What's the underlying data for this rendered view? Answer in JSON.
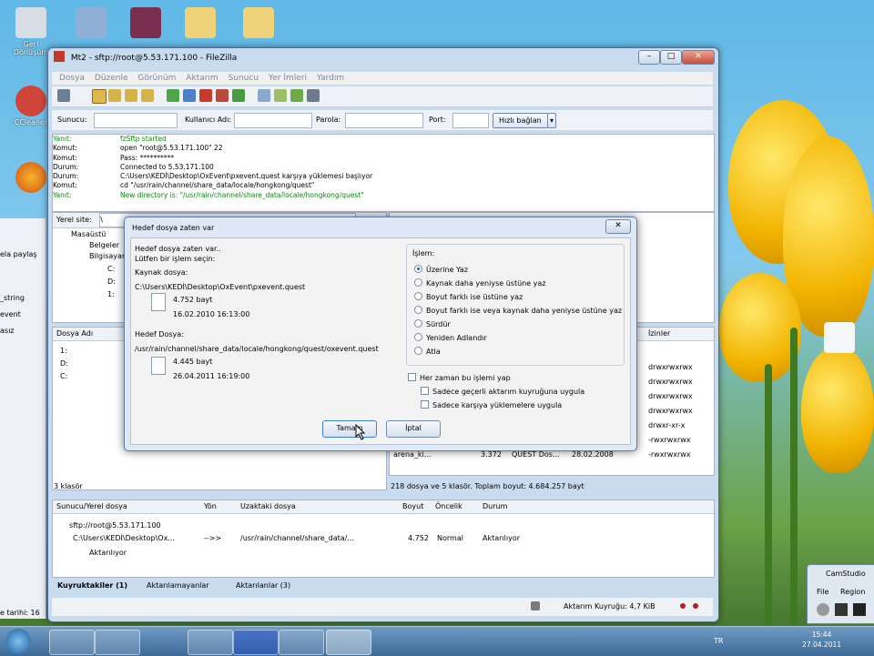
{
  "window": {
    "title": "Mt2 - sftp://root@5.53.171.100 - FileZilla",
    "btn_min": "–",
    "btn_max": "□",
    "btn_close": "✕"
  },
  "menu": [
    "Dosya",
    "Düzenle",
    "Görünüm",
    "Aktarım",
    "Sunucu",
    "Yer İmleri",
    "Yardım"
  ],
  "quickconnect": {
    "host_label": "Sunucu:",
    "user_label": "Kullanıcı Adı:",
    "pass_label": "Parola:",
    "port_label": "Port:",
    "connect_label": "Hızlı bağlan",
    "dropdown": "▾"
  },
  "log": [
    {
      "k": "Yanıt:",
      "v": "fzSftp started",
      "ok": true
    },
    {
      "k": "Komut:",
      "v": "open \"root@5.53.171.100\" 22",
      "ok": false
    },
    {
      "k": "Komut:",
      "v": "Pass: **********",
      "ok": false
    },
    {
      "k": "Durum:",
      "v": "Connected to 5.53.171.100",
      "ok": false
    },
    {
      "k": "Durum:",
      "v": "C:\\Users\\KEDİ\\Desktop\\OxEvent\\pxevent.quest karşıya yüklemesi başlıyor",
      "ok": false
    },
    {
      "k": "Komut:",
      "v": "cd \"/usr/rain/channel/share_data/locale/hongkong/quest\"",
      "ok": false
    },
    {
      "k": "Yanıt:",
      "v": "New directory is: \"/usr/rain/channel/share_data/locale/hongkong/quest\"",
      "ok": true
    }
  ],
  "local": {
    "site_label": "Yerel site:",
    "site_value": "\\",
    "tree": [
      "Masaüstü",
      "Belgeler",
      "Bilgisayar",
      "C:",
      "D:",
      "1:"
    ],
    "col_name": "Dosya Adı",
    "drives": [
      "1:",
      "D:",
      "C:"
    ],
    "status": "3 klasör"
  },
  "remote": {
    "col_perm": "İzinler",
    "perms": [
      "drwxrwxrwx",
      "drwxrwxrwx",
      "drwxrwxrwx",
      "drwxrwxrwx",
      "drwxr-xr-x",
      "-rwxrwxrwx",
      "-rwxrwxrwx"
    ],
    "row_name": "arena_ki...",
    "row_size": "3.372",
    "row_type": "QUEST Dos...",
    "row_date": "28.02.2008",
    "status": "218 dosya ve 5 klasör. Toplam boyut: 4.684.257 bayt"
  },
  "dialog": {
    "title": "Hedef dosya zaten var",
    "close": "✕",
    "msg1": "Hedef dosya zaten var..",
    "msg2": "Lütfen bir işlem seçin:",
    "source_label": "Kaynak dosya:",
    "source_path": "C:\\Users\\KEDİ\\Desktop\\OxEvent\\pxevent.quest",
    "source_size": "4.752 bayt",
    "source_date": "16.02.2010 16:13:00",
    "target_label": "Hedef Dosya:",
    "target_path": "/usr/rain/channel/share_data/locale/hongkong/quest/oxevent.quest",
    "target_size": "4.445 bayt",
    "target_date": "26.04.2011 16:19:00",
    "group_label": "İşlem:",
    "options": [
      "Üzerine Yaz",
      "Kaynak daha yeniyse üstüne yaz",
      "Boyut farklı ise üstüne yaz",
      "Boyut farklı ise veya kaynak daha yeniyse üstüne yaz",
      "Sürdür",
      "Yeniden Adlandır",
      "Atla"
    ],
    "selected_option": 0,
    "always_label": "Her zaman bu işlemi yap",
    "sub1": "Sadece geçerli aktarım kuyruğuna uygula",
    "sub2": "Sadece karşıya yüklemelere uygula",
    "ok_label": "Tamam",
    "cancel_label": "İptal"
  },
  "queue": {
    "headers": [
      "Sunucu/Yerel dosya",
      "Yön",
      "Uzaktaki dosya",
      "Boyut",
      "Öncelik",
      "Durum"
    ],
    "server": "sftp://root@5.53.171.100",
    "local_file": "C:\\Users\\KEDİ\\Desktop\\Ox...",
    "direction": "-->>",
    "remote_file": "/usr/rain/channel/share_data/...",
    "size": "4.752",
    "priority": "Normal",
    "state": "Aktarılıyor",
    "state2": "Aktarılıyor",
    "tabs": [
      "Kuyruktakiler (1)",
      "Aktarılamayanlar",
      "Aktarılanlar (3)"
    ]
  },
  "statusbar": {
    "queue_text": "Aktarım Kuyruğu: 4,7 KiB"
  },
  "desktop": {
    "icons": [
      "Geri Dönüşüm",
      "CCleaner",
      "",
      ""
    ],
    "left_fragments": [
      "ela paylaş",
      "_string",
      "event",
      "asız"
    ],
    "left_bottom": "e tarihi: 16"
  },
  "taskbar": {
    "lang": "TR",
    "time": "15:44",
    "date": "27.04.2011"
  },
  "camstudio": {
    "title": "CamStudio",
    "menu_file": "File",
    "menu_region": "Region"
  },
  "colors": {
    "accent": "#1f5fb8",
    "log_ok": "#0a8a0a",
    "desktop_sky": "#5fb8e6",
    "tulip": "#f2b400"
  }
}
